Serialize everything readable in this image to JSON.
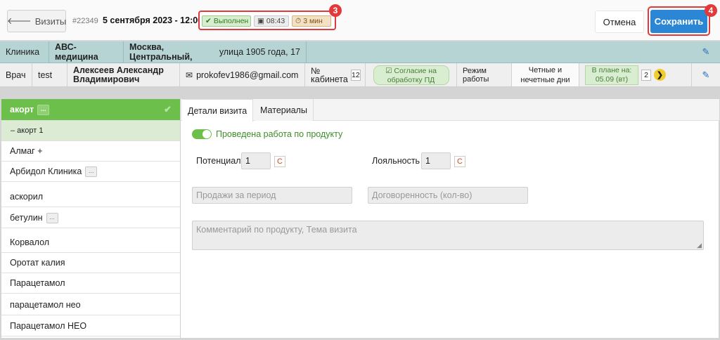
{
  "header": {
    "back_label": "Визиты",
    "visit_number": "#22349",
    "visit_date": "5 сентября 2023 - 12:00",
    "status_done": "Выполнен",
    "time": "08:43",
    "duration": "3 мин",
    "badge_status": "3",
    "badge_save": "4",
    "cancel_label": "Отмена",
    "save_label": "Сохранить"
  },
  "clinic_row": {
    "label": "Клиника",
    "name": "АВС-медицина",
    "address_city": "Москва, Центральный,",
    "address_street": " улица 1905 года, 17"
  },
  "doctor_row": {
    "label": "Врач",
    "specialty": "test",
    "name_line1": "Алексеев Александр",
    "name_line2": "Владимирович",
    "email": "prokofev1986@gmail.com",
    "cabinet_label_1": "№",
    "cabinet_label_2": "кабинета",
    "cabinet_value": "12",
    "consent_line1": "Согласие на",
    "consent_line2": "обработку ПД",
    "schedule_label_1": "Режим",
    "schedule_label_2": "работы",
    "schedule_value_1": "Четные и",
    "schedule_value_2": "нечетные дни",
    "plan_line1": "В плане на:",
    "plan_line2": "05.09 (вт)",
    "plan_count": "2"
  },
  "products": {
    "active": "акорт",
    "active_sub": "– акорт 1",
    "items": [
      "Алмаг +",
      "Арбидол Клиника",
      "аскорил",
      "бетулин",
      "Корвалол",
      "Оротат калия",
      "Парацетамол",
      "парацетамол нео",
      "Парацетамол НЕО"
    ]
  },
  "tabs": {
    "details": "Детали визита",
    "materials": "Материалы"
  },
  "form": {
    "toggle_label": "Проведена работа по продукту",
    "potential_label": "Потенциал",
    "potential_value": "1",
    "loyalty_label": "Лояльность",
    "loyalty_value": "1",
    "c_label": "С",
    "sales_placeholder": "Продажи за период",
    "agreement_placeholder": "Договоренность (кол-во)",
    "comment_placeholder": "Комментарий по продукту, Тема визита"
  },
  "colors": {
    "accent_green": "#6dbf4b",
    "save_blue": "#2b86d6",
    "highlight_red": "#e23a3a",
    "clinic_row_bg": "#b5d4d3"
  }
}
